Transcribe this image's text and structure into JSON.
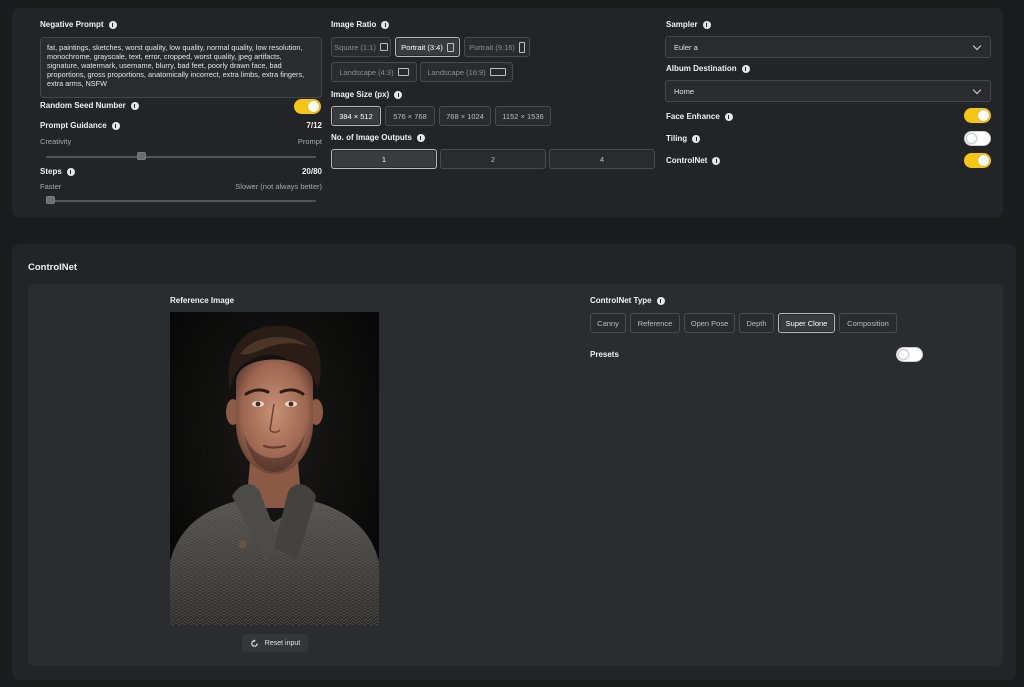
{
  "settings": {
    "negative_prompt": {
      "label": "Negative Prompt",
      "value": "fat, paintings, sketches, worst quality, low quality, normal quality, low resolution, monochrome, grayscale, text, error, cropped, worst quality, jpeg artifacts, signature, watermark, username, blurry, bad feet, poorly drawn face, bad proportions, gross proportions, anatomically incorrect, extra limbs, extra fingers, extra arms, NSFW"
    },
    "random_seed": {
      "label": "Random Seed Number",
      "enabled": true
    },
    "prompt_guidance": {
      "label": "Prompt Guidance",
      "value_text": "7/12",
      "left_text": "Creativity",
      "right_text": "Prompt",
      "value": 7,
      "max": 12
    },
    "steps": {
      "label": "Steps",
      "value_text": "20/80",
      "left_text": "Faster",
      "right_text": "Slower (not always better)",
      "value": 20,
      "max": 80
    },
    "image_ratio": {
      "label": "Image Ratio",
      "options": [
        {
          "label": "Square (1:1)",
          "selected": false
        },
        {
          "label": "Portrait (3:4)",
          "selected": true
        },
        {
          "label": "Portrait (9:16)",
          "selected": false
        },
        {
          "label": "Landscape (4:3)",
          "selected": false
        },
        {
          "label": "Landscape (16:9)",
          "selected": false
        }
      ]
    },
    "image_size": {
      "label": "Image Size (px)",
      "options": [
        "384 × 512",
        "576 × 768",
        "768 × 1024",
        "1152 × 1536"
      ],
      "selected": "384 × 512"
    },
    "image_outputs": {
      "label": "No. of Image Outputs",
      "options": [
        "1",
        "2",
        "4"
      ],
      "selected": "1"
    },
    "sampler": {
      "label": "Sampler",
      "value": "Euler a"
    },
    "album_destination": {
      "label": "Album Destination",
      "value": "Home"
    },
    "face_enhance": {
      "label": "Face Enhance",
      "enabled": true
    },
    "tiling": {
      "label": "Tiling",
      "enabled": false
    },
    "controlnet_toggle": {
      "label": "ControlNet",
      "enabled": true
    }
  },
  "controlnet": {
    "section_title": "ControlNet",
    "reference_image_label": "Reference Image",
    "reset_label": "Reset input",
    "type_label": "ControlNet Type",
    "types": [
      "Canny",
      "Reference",
      "Open Pose",
      "Depth",
      "Super Clone",
      "Composition"
    ],
    "selected_type": "Super Clone",
    "presets": {
      "label": "Presets",
      "enabled": false
    }
  },
  "colors": {
    "accent": "#f5c518",
    "panel": "#232427",
    "background": "#1a1b1d"
  }
}
